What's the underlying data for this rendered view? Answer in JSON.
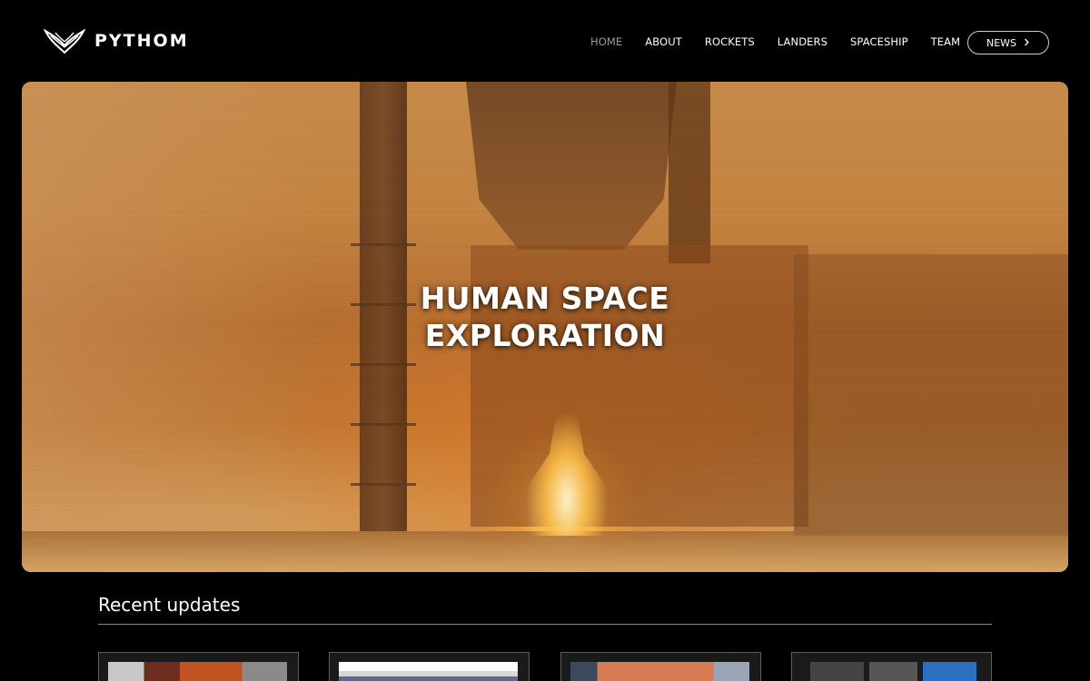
{
  "brand": {
    "name": "PYTHOM",
    "logo_icon": "wings-logo-icon"
  },
  "nav": {
    "items": [
      {
        "label": "HOME",
        "active": true
      },
      {
        "label": "ABOUT",
        "active": false
      },
      {
        "label": "ROCKETS",
        "active": false
      },
      {
        "label": "LANDERS",
        "active": false
      },
      {
        "label": "SPACESHIP",
        "active": false
      },
      {
        "label": "TEAM",
        "active": false
      }
    ],
    "news_button": {
      "label": "NEWS",
      "icon": "chevron-right-icon"
    }
  },
  "hero": {
    "title_line1": "HUMAN SPACE",
    "title_line2": "EXPLORATION"
  },
  "updates": {
    "title": "Recent updates",
    "cards": [
      {
        "thumb_colors": [
          "#6d2d1c",
          "#c0531f",
          "#8a8a8a"
        ]
      },
      {
        "thumb_colors": [
          "#d8d8d8",
          "#5a6a8a",
          "#ffffff"
        ]
      },
      {
        "thumb_colors": [
          "#3a4a5a",
          "#d67a52",
          "#9aa5b5"
        ]
      },
      {
        "thumb_colors": [
          "#1b1b1b",
          "#444444",
          "#2a6fc0"
        ]
      }
    ]
  },
  "colors": {
    "background": "#000000",
    "text": "#ffffff",
    "nav_active": "#9a9a9a",
    "hero_tint": "#c6843f"
  }
}
